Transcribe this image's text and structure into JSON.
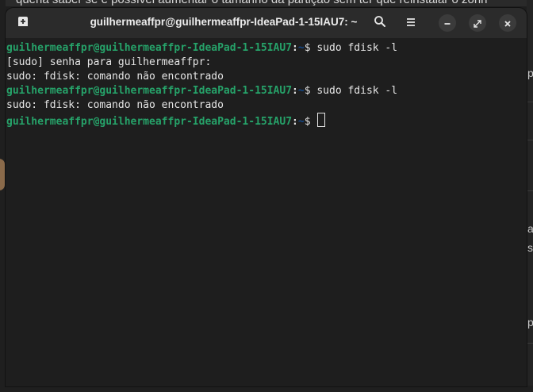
{
  "background": {
    "top_text": "queria saber se é possível aumentar o tamanho da partição sem ter que reinstalar o zorin",
    "right_fragments": [
      "p",
      "a",
      "s",
      "p"
    ]
  },
  "terminal": {
    "title": "guilhermeaffpr@guilhermeaffpr-IdeaPad-1-15IAU7: ~",
    "icons": {
      "new_tab": "new-tab-icon",
      "search": "search-icon",
      "menu": "hamburger-menu-icon",
      "minimize": "minimize-icon",
      "maximize": "maximize-icon",
      "close": "close-icon"
    },
    "prompt": {
      "user_host": "guilhermeaffpr@guilhermeaffpr-IdeaPad-1-15IAU7",
      "separator": ":",
      "path": "~",
      "symbol": "$ "
    },
    "lines": [
      {
        "type": "prompt",
        "command": "sudo fdisk -l"
      },
      {
        "type": "output",
        "text": "[sudo] senha para guilhermeaffpr:"
      },
      {
        "type": "output",
        "text": "sudo: fdisk: comando não encontrado"
      },
      {
        "type": "prompt",
        "command": "sudo fdisk -l"
      },
      {
        "type": "output",
        "text": "sudo: fdisk: comando não encontrado"
      },
      {
        "type": "prompt",
        "command": ""
      }
    ],
    "colors": {
      "user_host": "#26a269",
      "path": "#12488b",
      "text": "#e5e5e5",
      "background": "#1e1e1e",
      "titlebar": "#2b2b2b"
    }
  }
}
